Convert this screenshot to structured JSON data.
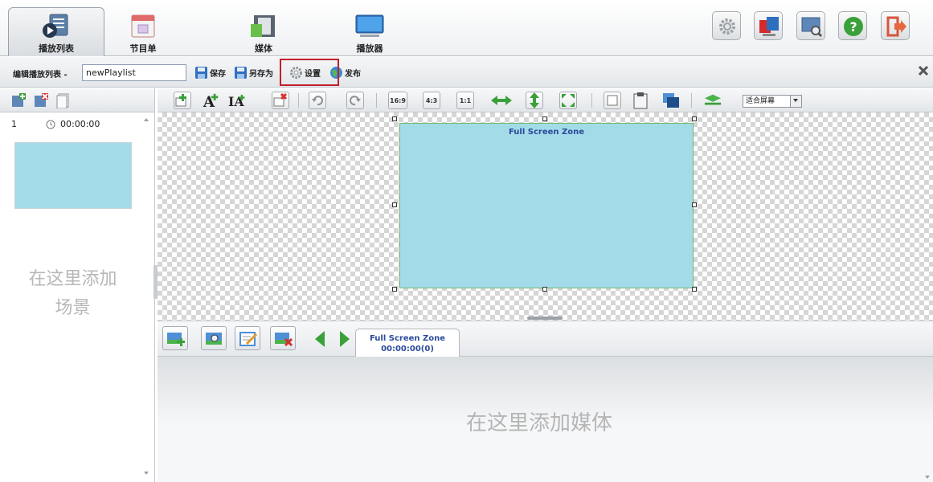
{
  "nav": {
    "tabs": [
      {
        "label": "播放列表",
        "icon": "playlist-icon"
      },
      {
        "label": "节目单",
        "icon": "calendar-icon"
      },
      {
        "label": "媒体",
        "icon": "film-icon"
      },
      {
        "label": "播放器",
        "icon": "monitor-icon"
      }
    ],
    "active_tab": 0,
    "right_buttons": [
      "gear-icon",
      "displays-icon",
      "screen-search-icon",
      "help-icon",
      "logout-icon"
    ]
  },
  "editor": {
    "label": "编辑播放列表 -",
    "playlist_name": "newPlaylist",
    "save_label": "保存",
    "save_as_label": "另存为",
    "settings_label": "设置",
    "publish_label": "发布"
  },
  "scenes": {
    "items": [
      {
        "index": "1",
        "duration": "00:00:00"
      }
    ],
    "empty_hint": "在这里添加场景"
  },
  "canvas_toolbar": {
    "ratio_16_9": "16:9",
    "ratio_4_3": "4:3",
    "ratio_1_1": "1:1",
    "fit_option": "适合屏幕"
  },
  "zone": {
    "label": "Full Screen Zone"
  },
  "media": {
    "tab_title": "Full Screen Zone",
    "tab_time": "00:00:00(0)",
    "empty_hint": "在这里添加媒体"
  },
  "colors": {
    "zone_fill": "#a4dbe9",
    "zone_border": "#6fba6f",
    "highlight": "#c0202c"
  }
}
